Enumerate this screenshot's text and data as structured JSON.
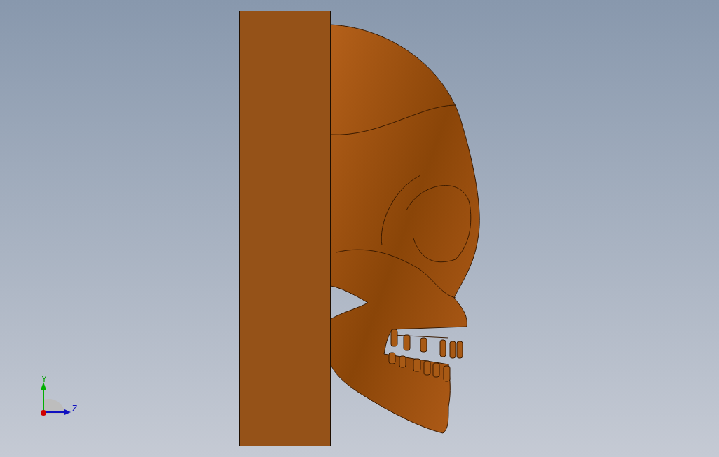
{
  "viewport": {
    "triad": {
      "axes": [
        {
          "kind": "y",
          "label": "Y"
        },
        {
          "kind": "z",
          "label": "Z"
        }
      ]
    }
  }
}
